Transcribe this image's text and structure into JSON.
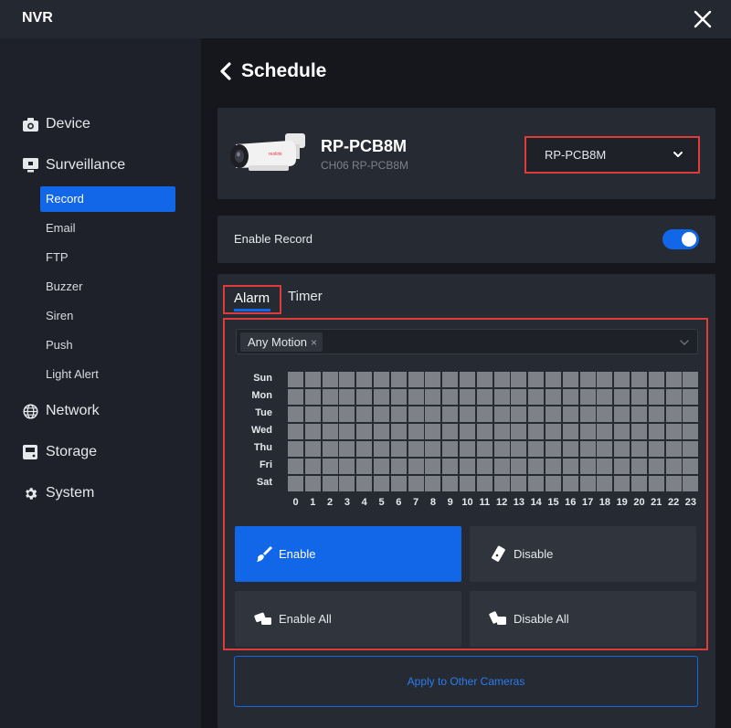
{
  "window": {
    "title": "NVR"
  },
  "sidebar": {
    "sections": [
      {
        "id": "device",
        "label": "Device",
        "icon": "camera-icon"
      },
      {
        "id": "surveillance",
        "label": "Surveillance",
        "icon": "monitor-icon"
      },
      {
        "id": "network",
        "label": "Network",
        "icon": "globe-icon"
      },
      {
        "id": "storage",
        "label": "Storage",
        "icon": "storage-icon"
      },
      {
        "id": "system",
        "label": "System",
        "icon": "gear-icon"
      }
    ],
    "surveillance_items": [
      {
        "label": "Record",
        "active": true
      },
      {
        "label": "Email"
      },
      {
        "label": "FTP"
      },
      {
        "label": "Buzzer"
      },
      {
        "label": "Siren"
      },
      {
        "label": "Push"
      },
      {
        "label": "Light Alert"
      }
    ]
  },
  "page": {
    "title": "Schedule",
    "back_icon": "chevron-left-icon"
  },
  "camera": {
    "name": "RP-PCB8M",
    "subtitle": "CH06 RP-PCB8M",
    "selector_value": "RP-PCB8M"
  },
  "enable_record": {
    "label": "Enable Record",
    "on": true
  },
  "tabs": {
    "alarm": "Alarm",
    "timer": "Timer",
    "active": "alarm"
  },
  "schedule": {
    "trigger_tag": "Any Motion",
    "tag_remove": "×",
    "days": [
      "Sun",
      "Mon",
      "Tue",
      "Wed",
      "Thu",
      "Fri",
      "Sat"
    ],
    "hours": [
      "0",
      "1",
      "2",
      "3",
      "4",
      "5",
      "6",
      "7",
      "8",
      "9",
      "10",
      "11",
      "12",
      "13",
      "14",
      "15",
      "16",
      "17",
      "18",
      "19",
      "20",
      "21",
      "22",
      "23"
    ],
    "cell_color": "#7e8188"
  },
  "actions": {
    "enable": "Enable",
    "disable": "Disable",
    "enable_all": "Enable All",
    "disable_all": "Disable All"
  },
  "apply": {
    "label": "Apply to Other Cameras"
  },
  "colors": {
    "accent": "#1266e8",
    "highlight_border": "#e03b3b",
    "background": "#15171c",
    "panel": "#262a32"
  }
}
